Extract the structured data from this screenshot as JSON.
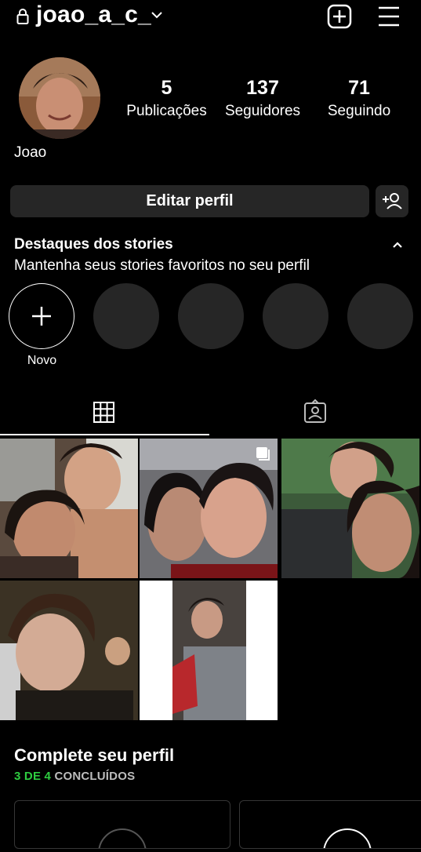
{
  "header": {
    "username": "joao_a_c_",
    "lock_icon": "lock-icon",
    "switch_icon": "chevron-down-icon",
    "new_post_icon": "plus-square-icon",
    "menu_icon": "hamburger-menu-icon"
  },
  "profile": {
    "name": "Joao",
    "stats": [
      {
        "value": "5",
        "label": "Publicações"
      },
      {
        "value": "137",
        "label": "Seguidores"
      },
      {
        "value": "71",
        "label": "Seguindo"
      }
    ]
  },
  "actions": {
    "edit_label": "Editar perfil",
    "discover_icon": "add-person-icon"
  },
  "highlights": {
    "title": "Destaques dos stories",
    "subtitle": "Mantenha seus stories favoritos no seu perfil",
    "new_label": "Novo"
  },
  "tabs": [
    {
      "icon": "grid-icon",
      "active": true
    },
    {
      "icon": "tagged-person-icon",
      "active": false
    }
  ],
  "complete_profile": {
    "title": "Complete seu perfil",
    "done": "3 DE 4",
    "done_suffix": "CONCLUÍDOS"
  },
  "colors": {
    "background": "#000000",
    "button": "#262626",
    "accent_green": "#2ecc40"
  }
}
